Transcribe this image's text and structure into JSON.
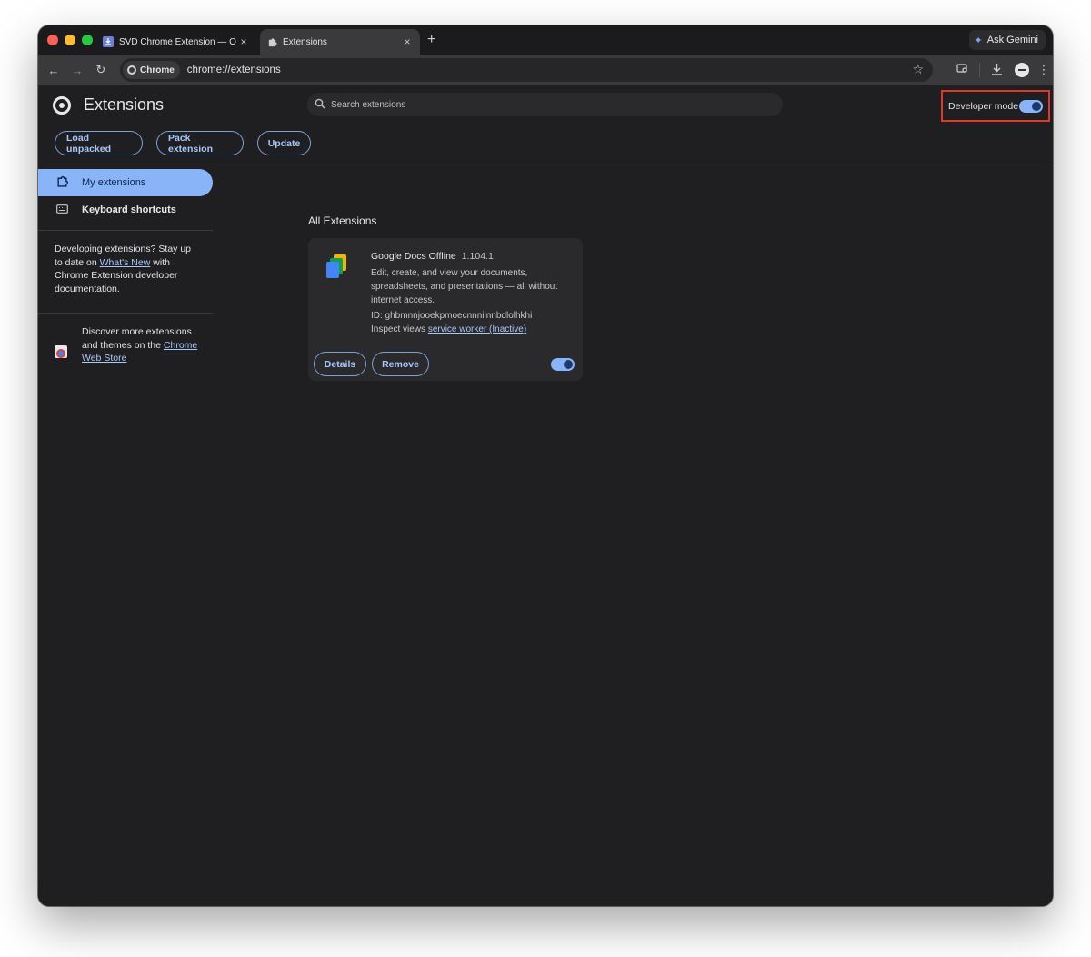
{
  "browser": {
    "tabs": [
      {
        "title": "SVD Chrome Extension — On",
        "active": false
      },
      {
        "title": "Extensions",
        "active": true
      }
    ],
    "new_tab": "+",
    "close": "×",
    "gemini_label": "Ask Gemini",
    "omnibox": {
      "chip": "Chrome",
      "url": "chrome://extensions"
    }
  },
  "header": {
    "title": "Extensions",
    "search_placeholder": "Search extensions",
    "developer_mode_label": "Developer mode",
    "developer_mode_on": true
  },
  "actions": {
    "load_unpacked": "Load unpacked",
    "pack_extension": "Pack extension",
    "update": "Update"
  },
  "sidebar": {
    "items": [
      {
        "label": "My extensions",
        "active": true
      },
      {
        "label": "Keyboard shortcuts",
        "active": false
      }
    ],
    "dev_note": {
      "pre": "Developing extensions? Stay up to date on ",
      "link": "What's New",
      "post": " with Chrome Extension developer documentation."
    },
    "webstore": {
      "pre": "Discover more extensions and themes on the ",
      "link": "Chrome Web Store"
    }
  },
  "main": {
    "section_title": "All Extensions",
    "extensions": [
      {
        "name": "Google Docs Offline",
        "version": "1.104.1",
        "description": "Edit, create, and view your documents, spreadsheets, and presentations — all without internet access.",
        "id_label": "ID: ghbmnnjooekpmoecnnnilnnbdlolhkhi",
        "inspect_label": "Inspect views",
        "inspect_link": "service worker (Inactive)",
        "details": "Details",
        "remove": "Remove",
        "enabled": true
      }
    ]
  },
  "colors": {
    "accent": "#8ab4f8",
    "highlight_box": "#e0392b",
    "page_bg": "#1f1f21"
  }
}
